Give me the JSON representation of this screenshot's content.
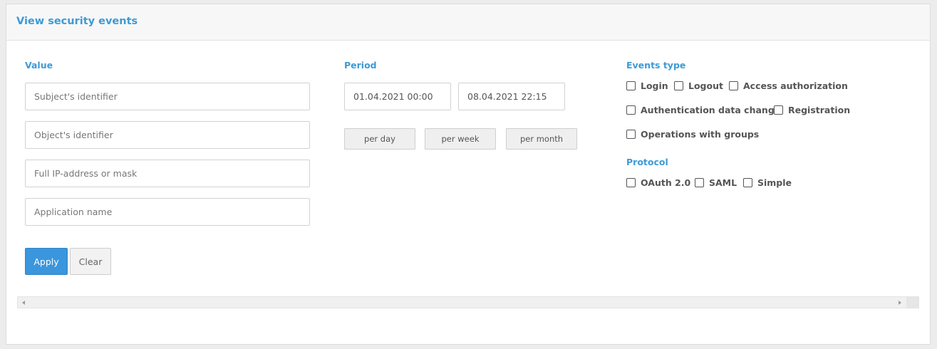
{
  "header": {
    "title": "View security events"
  },
  "value_section": {
    "label": "Value",
    "fields": [
      {
        "placeholder": "Subject's identifier",
        "value": ""
      },
      {
        "placeholder": "Object's identifier",
        "value": ""
      },
      {
        "placeholder": "Full IP-address or mask",
        "value": ""
      },
      {
        "placeholder": "Application name",
        "value": ""
      }
    ]
  },
  "period_section": {
    "label": "Period",
    "from": "01.04.2021 00:00",
    "to": "08.04.2021 22:15",
    "buttons": [
      "per day",
      "per week",
      "per month"
    ]
  },
  "events_section": {
    "label": "Events type",
    "options": [
      {
        "label": "Login",
        "checked": false
      },
      {
        "label": "Logout",
        "checked": false
      },
      {
        "label": "Access authorization",
        "checked": false
      },
      {
        "label": "Authentication data change",
        "checked": false
      },
      {
        "label": "Registration",
        "checked": false
      },
      {
        "label": "Operations with groups",
        "checked": false
      }
    ]
  },
  "protocol_section": {
    "label": "Protocol",
    "options": [
      {
        "label": "OAuth 2.0",
        "checked": false
      },
      {
        "label": "SAML",
        "checked": false
      },
      {
        "label": "Simple",
        "checked": false
      }
    ]
  },
  "actions": {
    "apply": "Apply",
    "clear": "Clear"
  },
  "colors": {
    "accent": "#3d9ad6",
    "primary_button": "#3a96dd"
  }
}
